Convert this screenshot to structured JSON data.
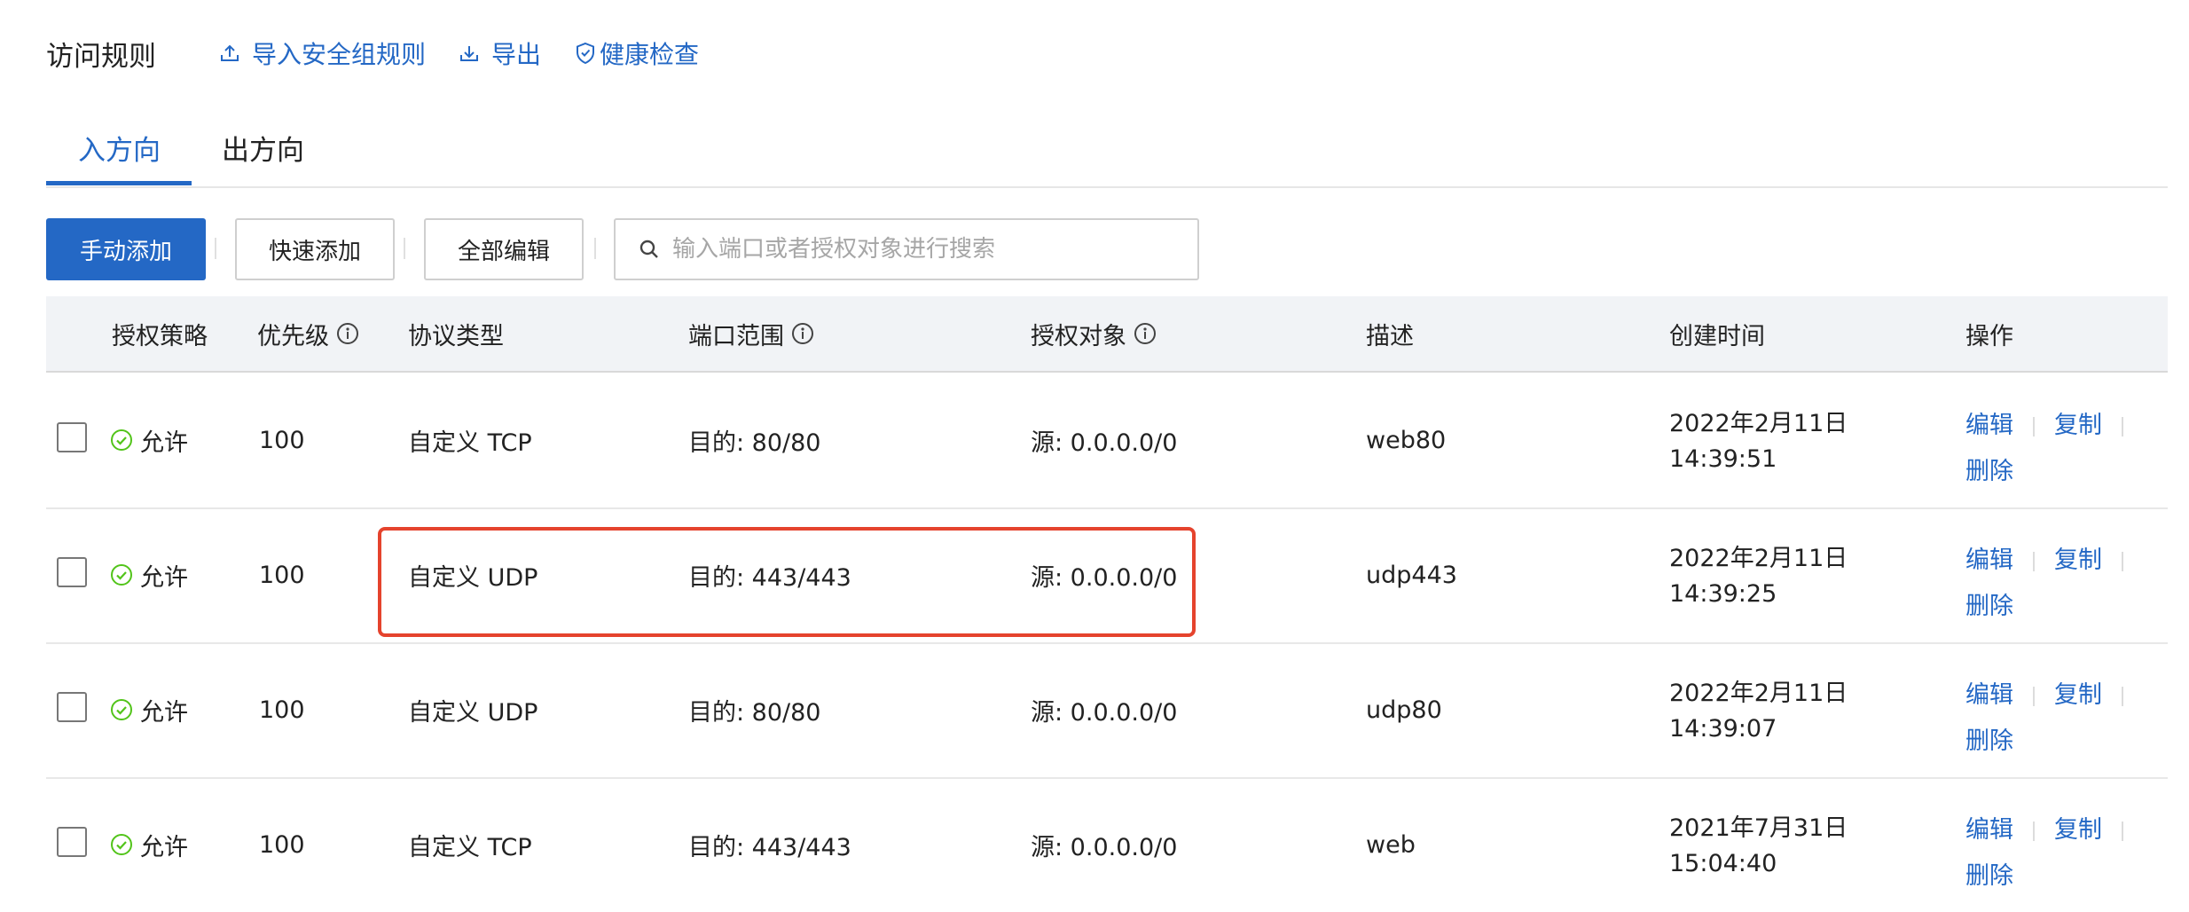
{
  "header": {
    "title": "访问规则",
    "import_label": "导入安全组规则",
    "export_label": "导出",
    "health_label": "健康检查"
  },
  "tabs": [
    {
      "label": "入方向",
      "active": true
    },
    {
      "label": "出方向",
      "active": false
    }
  ],
  "toolbar": {
    "manual_add": "手动添加",
    "quick_add": "快速添加",
    "edit_all": "全部编辑",
    "search_placeholder": "输入端口或者授权对象进行搜索"
  },
  "columns": [
    "授权策略",
    "优先级",
    "协议类型",
    "端口范围",
    "授权对象",
    "描述",
    "创建时间",
    "操作"
  ],
  "rows": [
    {
      "policy": "允许",
      "priority": "100",
      "protocol": "自定义 TCP",
      "port": "目的: 80/80",
      "target": "源: 0.0.0.0/0",
      "desc": "web80",
      "date": "2022年2月11日",
      "time": "14:39:51"
    },
    {
      "policy": "允许",
      "priority": "100",
      "protocol": "自定义 UDP",
      "port": "目的: 443/443",
      "target": "源: 0.0.0.0/0",
      "desc": "udp443",
      "date": "2022年2月11日",
      "time": "14:39:25"
    },
    {
      "policy": "允许",
      "priority": "100",
      "protocol": "自定义 UDP",
      "port": "目的: 80/80",
      "target": "源: 0.0.0.0/0",
      "desc": "udp80",
      "date": "2022年2月11日",
      "time": "14:39:07"
    },
    {
      "policy": "允许",
      "priority": "100",
      "protocol": "自定义 TCP",
      "port": "目的: 443/443",
      "target": "源: 0.0.0.0/0",
      "desc": "web",
      "date": "2021年7月31日",
      "time": "15:04:40"
    }
  ],
  "actions": {
    "edit": "编辑",
    "copy": "复制",
    "delete": "删除"
  },
  "colors": {
    "accent": "#2468c5",
    "success": "#52c41a",
    "highlight": "#e5432d"
  }
}
